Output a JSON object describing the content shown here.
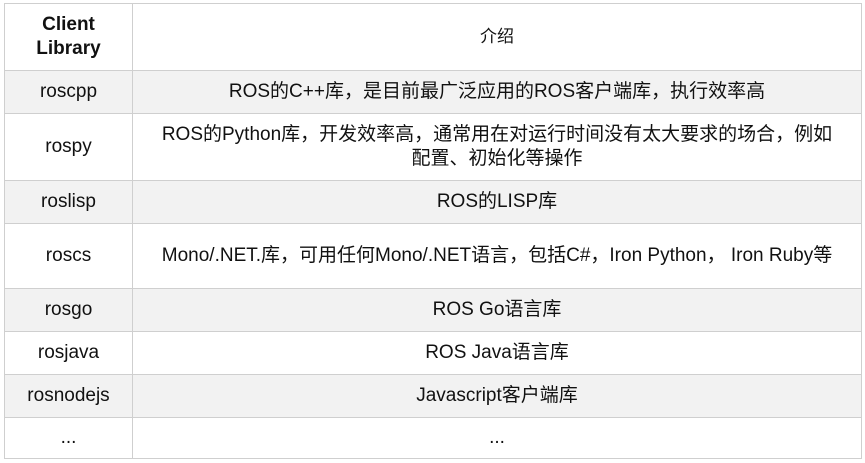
{
  "table": {
    "headers": {
      "library": "Client\nLibrary",
      "description": "介绍"
    },
    "rows": [
      {
        "library": "roscpp",
        "description": "ROS的C++库，是目前最广泛应用的ROS客户端库，执行效率高"
      },
      {
        "library": "rospy",
        "description": "ROS的Python库，开发效率高，通常用在对运行时间没有太大要求的场合，例如配置、初始化等操作"
      },
      {
        "library": "roslisp",
        "description": "ROS的LISP库"
      },
      {
        "library": "roscs",
        "description": "Mono/.NET.库，可用任何Mono/.NET语言，包括C#，Iron Python， Iron Ruby等"
      },
      {
        "library": "rosgo",
        "description": "ROS Go语言库"
      },
      {
        "library": "rosjava",
        "description": "ROS Java语言库"
      },
      {
        "library": "rosnodejs",
        "description": "Javascript客户端库"
      },
      {
        "library": "...",
        "description": "..."
      }
    ]
  }
}
